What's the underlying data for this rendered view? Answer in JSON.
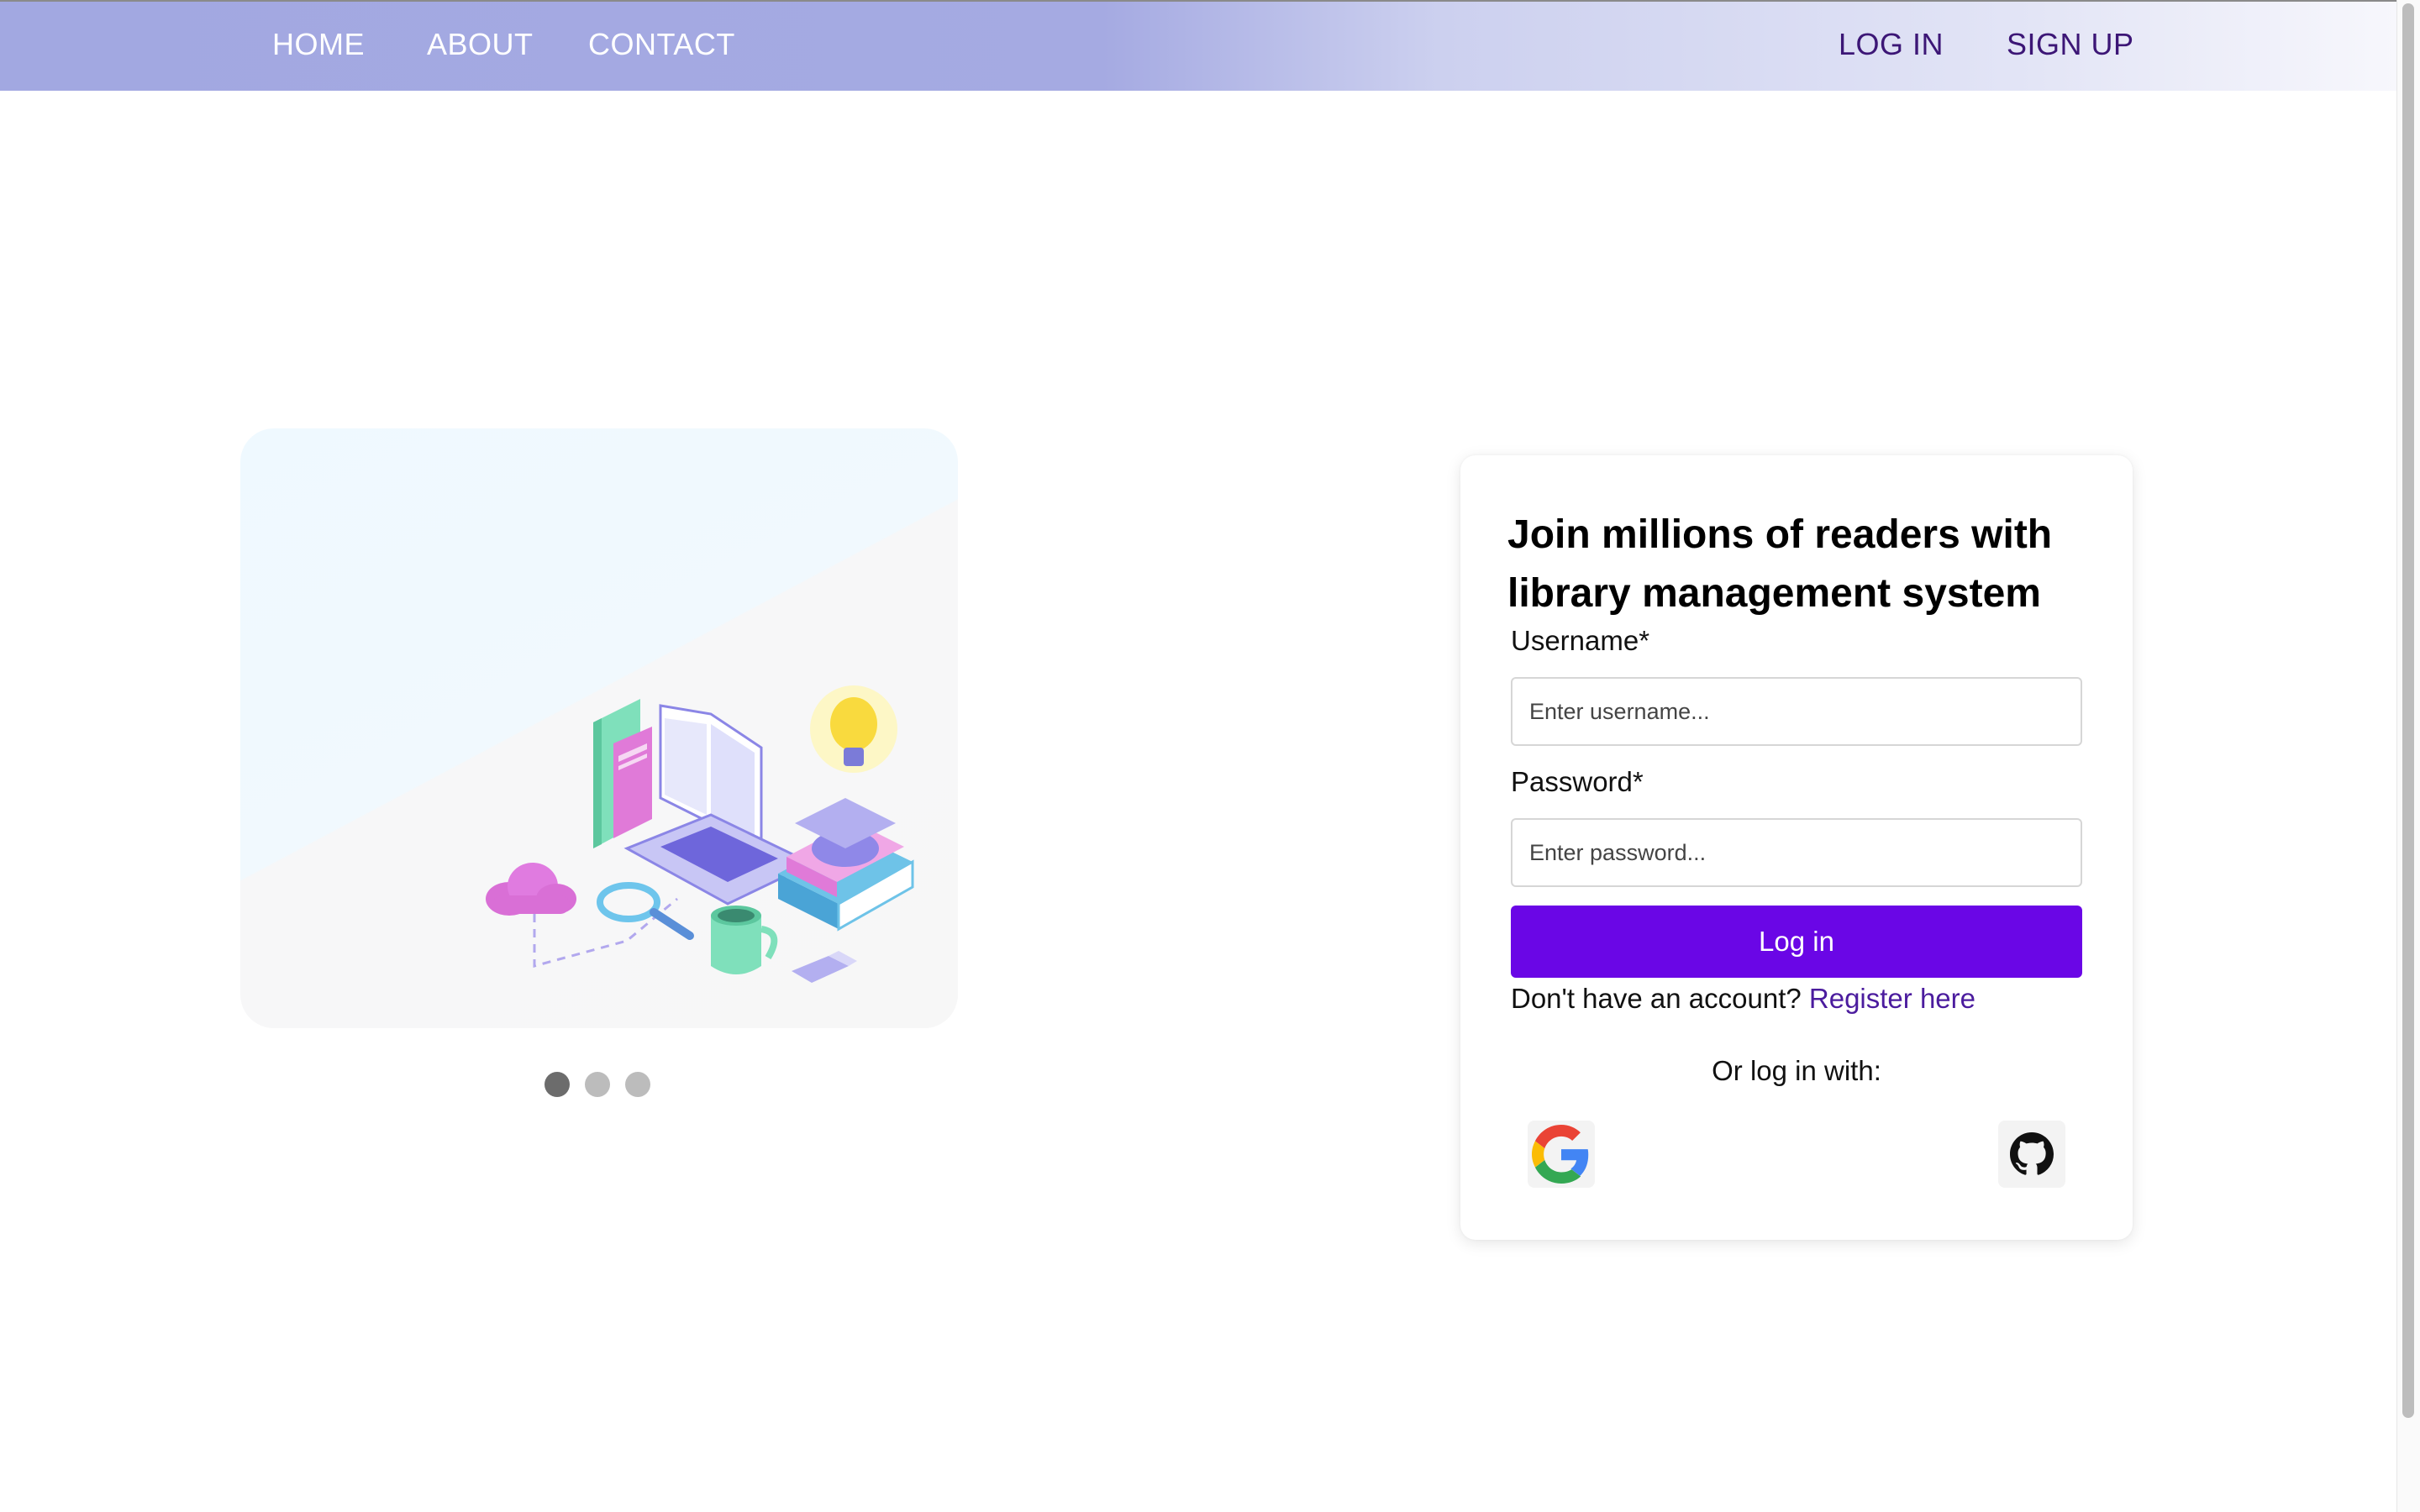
{
  "nav": {
    "left": [
      "HOME",
      "ABOUT",
      "CONTACT"
    ],
    "right": [
      "LOG IN",
      "SIGN UP"
    ]
  },
  "carousel": {
    "slide_count": 3,
    "active_index": 0
  },
  "login": {
    "title": "Join millions of readers with library management system",
    "username_label": "Username*",
    "username_placeholder": "Enter username...",
    "password_label": "Password*",
    "password_placeholder": "Enter password...",
    "submit_label": "Log in",
    "no_account_text": "Don't have an account?",
    "register_link": "Register here",
    "or_text": "Or log in with:",
    "social": [
      "google-icon",
      "github-icon"
    ]
  },
  "colors": {
    "accent": "#6a06e6",
    "nav_link_dark": "#3c1676",
    "link": "#4b1c9e"
  }
}
